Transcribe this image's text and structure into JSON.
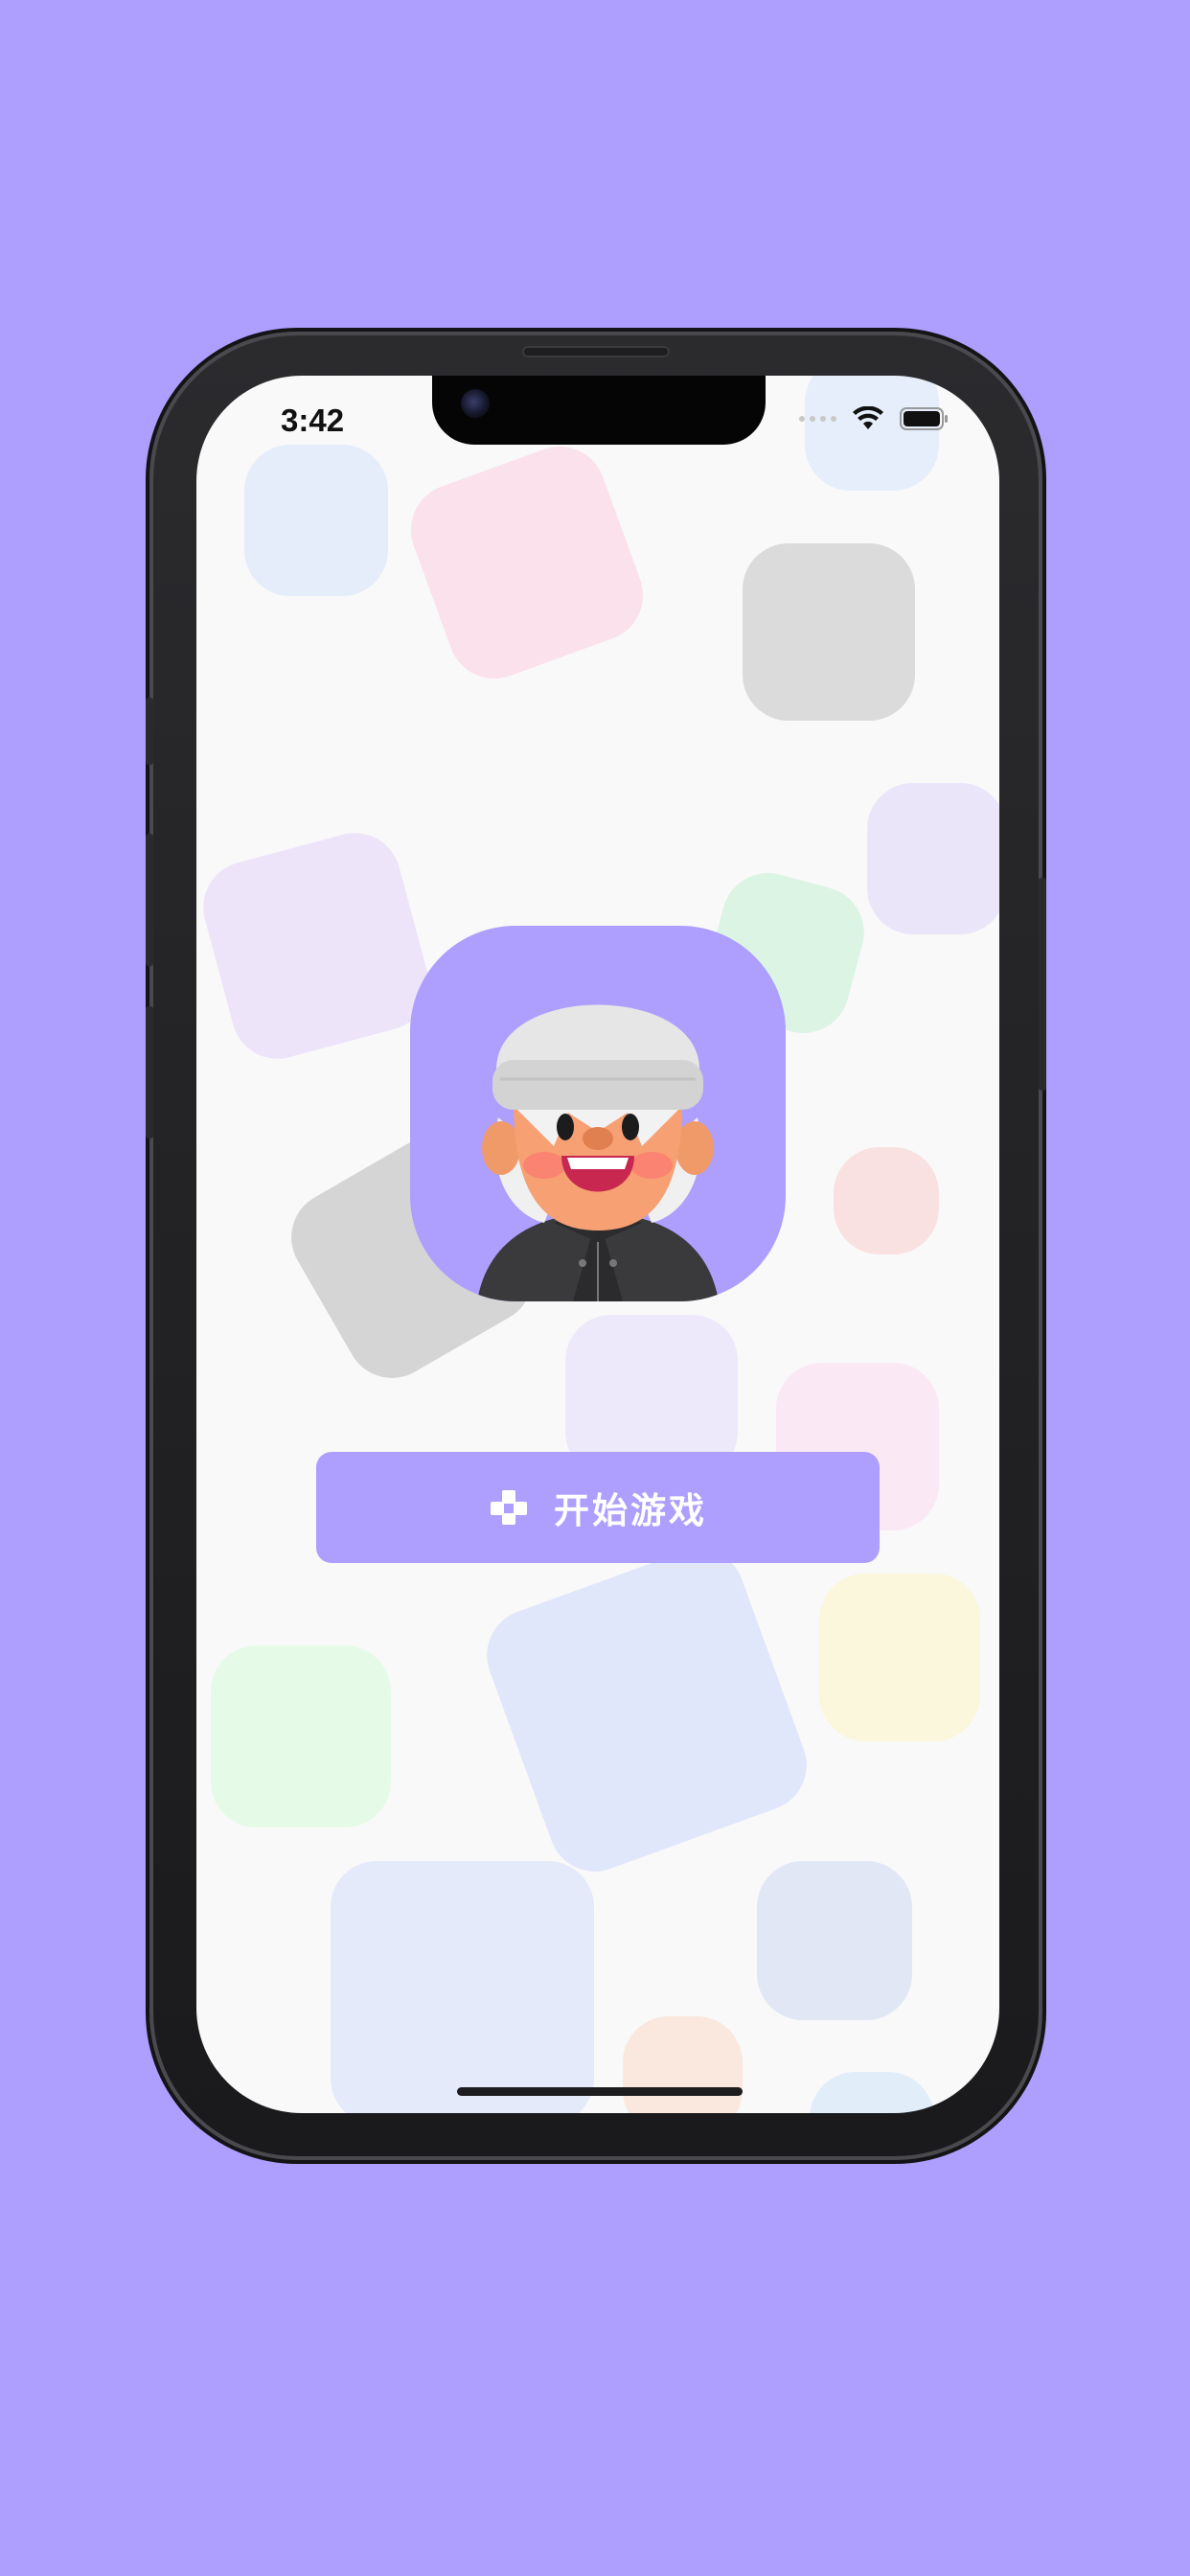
{
  "status_bar": {
    "time": "3:42",
    "wifi_icon": "wifi-icon",
    "battery_icon": "battery-icon"
  },
  "hero": {
    "avatar_icon": "avatar-beanie-man-icon",
    "tile_color": "#ae9fff"
  },
  "start_button": {
    "label": "开始游戏",
    "icon": "gamepad-icon",
    "color": "#ae9fff"
  },
  "background": {
    "page_color": "#ae9fff",
    "screen_color": "#f9f9f9",
    "avatar_tile_colors": [
      "#dbe6ff",
      "#ffd2e6",
      "#d8d8d8",
      "#e5d7ff",
      "#d6ffe0",
      "#ffe3a8",
      "#ffd5d5",
      "#fff2b0",
      "#d2ecff"
    ]
  }
}
